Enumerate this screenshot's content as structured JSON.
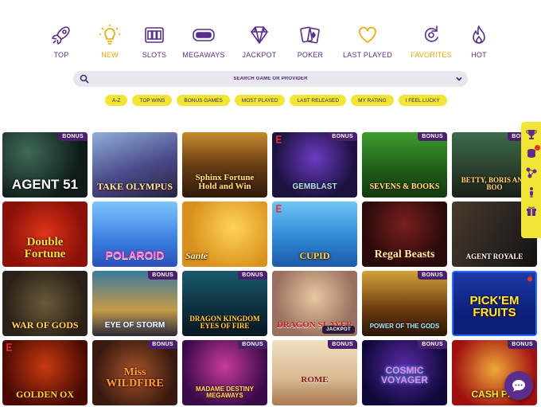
{
  "colors": {
    "accent": "#5b2d8c",
    "active": "#e6a800",
    "pill": "#f2e535",
    "search_bg": "#e8e6ee"
  },
  "categories": [
    {
      "label": "TOP",
      "icon": "rocket-icon"
    },
    {
      "label": "NEW",
      "icon": "lightbulb-icon"
    },
    {
      "label": "SLOTS",
      "icon": "slot-machine-icon"
    },
    {
      "label": "MEGAWAYS",
      "icon": "megaways-icon"
    },
    {
      "label": "JACKPOT",
      "icon": "diamond-icon"
    },
    {
      "label": "POKER",
      "icon": "cards-icon"
    },
    {
      "label": "LAST PLAYED",
      "icon": "heart-icon"
    },
    {
      "label": "FAVORITES",
      "icon": "refresh-icon"
    },
    {
      "label": "HOT",
      "icon": "flame-icon"
    }
  ],
  "search": {
    "placeholder": "SEARCH GAME OR PROVIDER"
  },
  "filters": [
    "A-Z",
    "TOP WINS",
    "BONUS GAMES",
    "MOST PLAYED",
    "LAST RELEASED",
    "MY RATING",
    "I FEEL LUCKY"
  ],
  "badge_label": "BONUS",
  "jackpot_label": "JACKPOT",
  "games": [
    {
      "title": "AGENT 51",
      "bonus": true
    },
    {
      "title": "TAKE OLYMPUS",
      "bonus": false
    },
    {
      "title": "Sphinx Fortune Hold and Win",
      "bonus": false
    },
    {
      "title": "GEMBLAST",
      "bonus": true
    },
    {
      "title": "SEVENS & BOOKS",
      "bonus": true
    },
    {
      "title": "BETTY, BORIS AND BOO",
      "bonus": true
    },
    {
      "title": "Double Fortune",
      "bonus": false
    },
    {
      "title": "POLAROID",
      "bonus": false
    },
    {
      "title": "Santé",
      "bonus": false
    },
    {
      "title": "CUPID",
      "bonus": false
    },
    {
      "title": "Regal Beasts",
      "bonus": false
    },
    {
      "title": "AGENT ROYALE",
      "bonus": false
    },
    {
      "title": "WAR OF GODS",
      "bonus": false
    },
    {
      "title": "EYE OF STORM",
      "bonus": true
    },
    {
      "title": "DRAGON KINGDOM EYES OF FIRE",
      "bonus": true
    },
    {
      "title": "DRAGON SLAYER",
      "bonus": false
    },
    {
      "title": "POWER OF THE GODS",
      "bonus": true
    },
    {
      "title": "PICK'EM FRUITS",
      "bonus": false
    },
    {
      "title": "GOLDEN OX",
      "bonus": false
    },
    {
      "title": "Miss WILDFIRE",
      "bonus": true
    },
    {
      "title": "MADAME DESTINY MEGAWAYS",
      "bonus": true
    },
    {
      "title": "ROME",
      "bonus": true
    },
    {
      "title": "COSMIC VOYAGER",
      "bonus": true
    },
    {
      "title": "CASH PIG",
      "bonus": true
    }
  ],
  "side_toolbar": [
    "trophy-icon",
    "coins-icon",
    "nodes-icon",
    "person-icon",
    "gift-icon"
  ],
  "chat": {
    "icon": "chat-icon"
  }
}
